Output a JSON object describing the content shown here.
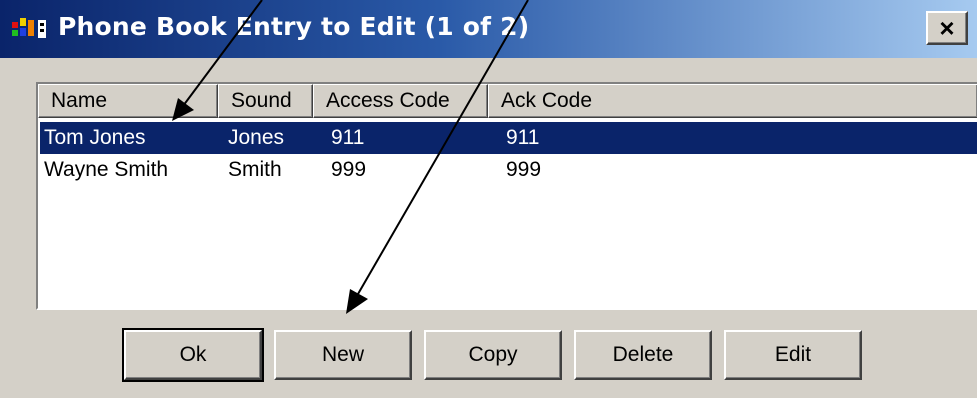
{
  "window": {
    "title": "Phone Book Entry to Edit (1 of 2)",
    "close_label": "×"
  },
  "listview": {
    "columns": [
      "Name",
      "Sound",
      "Access Code",
      "Ack Code"
    ],
    "rows": [
      {
        "name": "Tom Jones",
        "sound": "Jones",
        "access_code": "911",
        "ack_code": "911",
        "selected": true
      },
      {
        "name": "Wayne Smith",
        "sound": "Smith",
        "access_code": "999",
        "ack_code": "999",
        "selected": false
      }
    ]
  },
  "buttons": {
    "ok": "Ok",
    "new": "New",
    "copy": "Copy",
    "delete": "Delete",
    "edit": "Edit"
  },
  "colors": {
    "title_start": "#0a246a",
    "title_end": "#a6caf0",
    "selection": "#0a246a",
    "face": "#d4d0c8"
  }
}
